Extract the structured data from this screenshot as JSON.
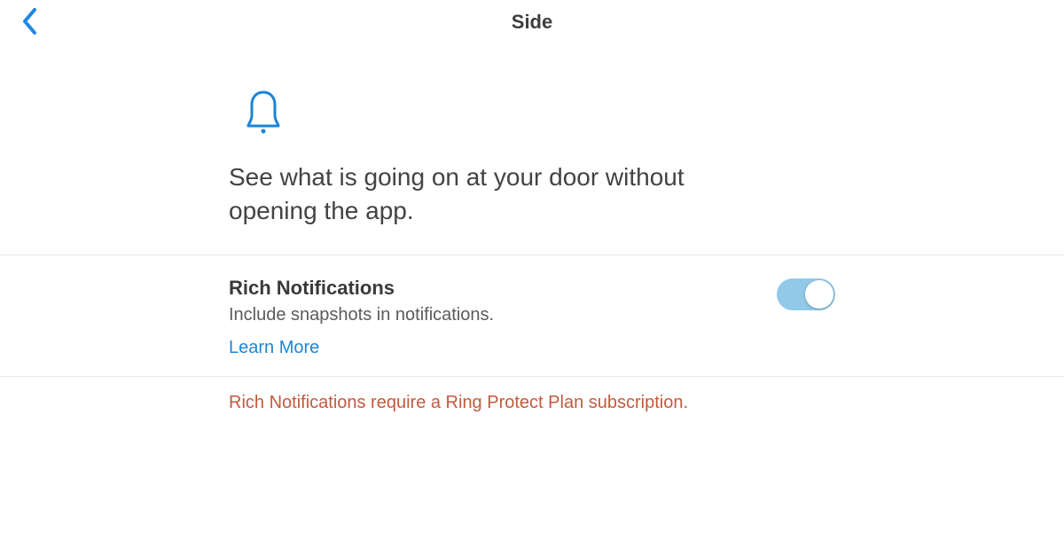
{
  "header": {
    "title": "Side"
  },
  "hero": {
    "headline": "See what is going on at your door without opening the app."
  },
  "setting": {
    "title": "Rich Notifications",
    "description": "Include snapshots in notifications.",
    "learn_more": "Learn More",
    "enabled": true
  },
  "footer": {
    "warning": "Rich Notifications require a Ring Protect Plan subscription."
  }
}
